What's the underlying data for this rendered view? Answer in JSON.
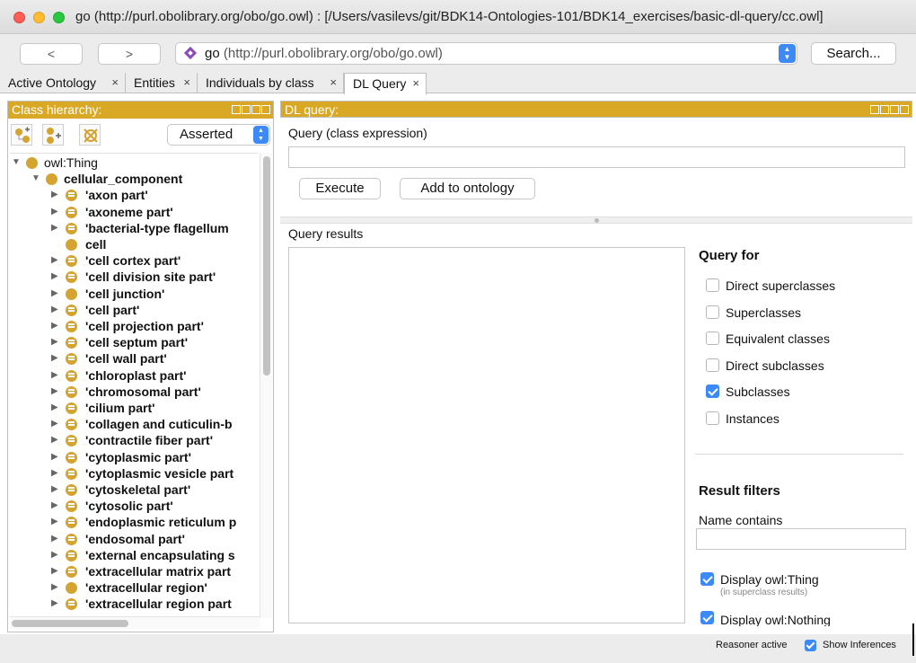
{
  "window": {
    "title": "go (http://purl.obolibrary.org/obo/go.owl)  : [/Users/vasilevs/git/BDK14-Ontologies-101/BDK14_exercises/basic-dl-query/cc.owl]"
  },
  "toolbar": {
    "back_label": "<",
    "forward_label": ">",
    "ontology_name": "go",
    "ontology_url": "(http://purl.obolibrary.org/obo/go.owl)",
    "search_label": "Search..."
  },
  "tabs": [
    {
      "label": "Active Ontology",
      "close": "×"
    },
    {
      "label": "Entities",
      "close": "×"
    },
    {
      "label": "Individuals by class",
      "close": "×"
    },
    {
      "label": "DL Query",
      "close": "×"
    }
  ],
  "class_hierarchy": {
    "title": "Class hierarchy:",
    "mode": "Asserted",
    "tree": [
      {
        "label": "owl:Thing",
        "level": 0,
        "twisty": "▼",
        "icon": "class-node",
        "bold": false
      },
      {
        "label": "cellular_component",
        "level": 1,
        "twisty": "▼",
        "icon": "class-node",
        "bold": true
      },
      {
        "label": "'axon part'",
        "level": 2,
        "twisty": "▶",
        "icon": "defined-class-node",
        "bold": true
      },
      {
        "label": "'axoneme part'",
        "level": 2,
        "twisty": "▶",
        "icon": "defined-class-node",
        "bold": true
      },
      {
        "label": "'bacterial-type flagellum",
        "level": 2,
        "twisty": "▶",
        "icon": "defined-class-node",
        "bold": true
      },
      {
        "label": "cell",
        "level": 2,
        "twisty": "",
        "icon": "class-node",
        "bold": true
      },
      {
        "label": "'cell cortex part'",
        "level": 2,
        "twisty": "▶",
        "icon": "defined-class-node",
        "bold": true
      },
      {
        "label": "'cell division site part'",
        "level": 2,
        "twisty": "▶",
        "icon": "defined-class-node",
        "bold": true
      },
      {
        "label": "'cell junction'",
        "level": 2,
        "twisty": "▶",
        "icon": "class-node",
        "bold": true
      },
      {
        "label": "'cell part'",
        "level": 2,
        "twisty": "▶",
        "icon": "defined-class-node",
        "bold": true
      },
      {
        "label": "'cell projection part'",
        "level": 2,
        "twisty": "▶",
        "icon": "defined-class-node",
        "bold": true
      },
      {
        "label": "'cell septum part'",
        "level": 2,
        "twisty": "▶",
        "icon": "defined-class-node",
        "bold": true
      },
      {
        "label": "'cell wall part'",
        "level": 2,
        "twisty": "▶",
        "icon": "defined-class-node",
        "bold": true
      },
      {
        "label": "'chloroplast part'",
        "level": 2,
        "twisty": "▶",
        "icon": "defined-class-node",
        "bold": true
      },
      {
        "label": "'chromosomal part'",
        "level": 2,
        "twisty": "▶",
        "icon": "defined-class-node",
        "bold": true
      },
      {
        "label": "'cilium part'",
        "level": 2,
        "twisty": "▶",
        "icon": "defined-class-node",
        "bold": true
      },
      {
        "label": "'collagen and cuticulin-b",
        "level": 2,
        "twisty": "▶",
        "icon": "defined-class-node",
        "bold": true
      },
      {
        "label": "'contractile fiber part'",
        "level": 2,
        "twisty": "▶",
        "icon": "defined-class-node",
        "bold": true
      },
      {
        "label": "'cytoplasmic part'",
        "level": 2,
        "twisty": "▶",
        "icon": "defined-class-node",
        "bold": true
      },
      {
        "label": "'cytoplasmic vesicle part",
        "level": 2,
        "twisty": "▶",
        "icon": "defined-class-node",
        "bold": true
      },
      {
        "label": "'cytoskeletal part'",
        "level": 2,
        "twisty": "▶",
        "icon": "defined-class-node",
        "bold": true
      },
      {
        "label": "'cytosolic part'",
        "level": 2,
        "twisty": "▶",
        "icon": "defined-class-node",
        "bold": true
      },
      {
        "label": "'endoplasmic reticulum p",
        "level": 2,
        "twisty": "▶",
        "icon": "defined-class-node",
        "bold": true
      },
      {
        "label": "'endosomal part'",
        "level": 2,
        "twisty": "▶",
        "icon": "defined-class-node",
        "bold": true
      },
      {
        "label": "'external encapsulating s",
        "level": 2,
        "twisty": "▶",
        "icon": "defined-class-node",
        "bold": true
      },
      {
        "label": "'extracellular matrix part",
        "level": 2,
        "twisty": "▶",
        "icon": "defined-class-node",
        "bold": true
      },
      {
        "label": "'extracellular region'",
        "level": 2,
        "twisty": "▶",
        "icon": "class-node",
        "bold": true
      },
      {
        "label": "'extracellular region part",
        "level": 2,
        "twisty": "▶",
        "icon": "defined-class-node",
        "bold": true
      }
    ]
  },
  "dl_query": {
    "title": "DL query:",
    "query_label": "Query (class expression)",
    "query_value": "",
    "execute_label": "Execute",
    "add_to_ontology_label": "Add to ontology",
    "results_label": "Query results",
    "query_for_title": "Query for",
    "query_for_options": [
      {
        "label": "Direct superclasses",
        "checked": false
      },
      {
        "label": "Superclasses",
        "checked": false
      },
      {
        "label": "Equivalent classes",
        "checked": false
      },
      {
        "label": "Direct subclasses",
        "checked": false
      },
      {
        "label": "Subclasses",
        "checked": true
      },
      {
        "label": "Instances",
        "checked": false
      }
    ],
    "result_filters_title": "Result filters",
    "name_contains_label": "Name contains",
    "name_contains_value": "",
    "display_owl_thing_label": "Display owl:Thing",
    "display_owl_thing_sub": "(in superclass results)",
    "display_owl_thing_checked": true,
    "display_owl_nothing_label": "Display owl:Nothing",
    "display_owl_nothing_checked": true
  },
  "status": {
    "reasoner": "Reasoner active",
    "show_inferences_label": "Show Inferences",
    "show_inferences_checked": true
  },
  "colors": {
    "panel_header": "#d9a926",
    "class_node": "#d4a330",
    "accent_blue": "#3d8af7"
  }
}
